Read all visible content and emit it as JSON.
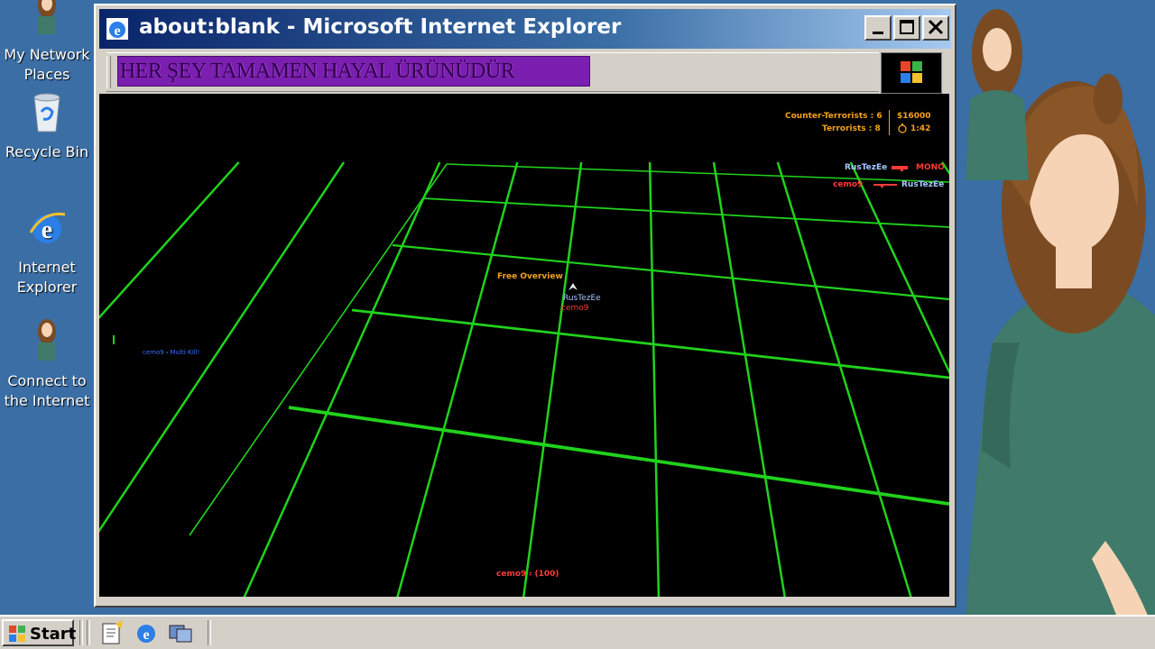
{
  "desktop": {
    "icons": [
      {
        "label": "My Network\nPlaces"
      },
      {
        "label": "Recycle Bin"
      },
      {
        "label": "Internet\nExplorer"
      },
      {
        "label": "Connect to\nthe Internet"
      }
    ]
  },
  "window": {
    "title": "about:blank - Microsoft Internet Explorer",
    "marquee": "HER ŞEY TAMAMEN HAYAL ÜRÜNÜDÜR"
  },
  "game": {
    "score": {
      "ct_label": "Counter-Terrorists : 6",
      "t_label": "Terrorists : 8",
      "money": "$16000",
      "timer": "1:42"
    },
    "killfeed": [
      {
        "killer": "RusTezEe",
        "weapon": "MONO"
      },
      {
        "killer": "cemo9",
        "victim": "RusTezEe"
      }
    ],
    "overview_label": "Free Overview",
    "player_name": "RusTezEe",
    "player_name_2": "cemo9",
    "left_notice": "cemo9 ⸗ Multi-Kill!",
    "bottom_status": "cemo9 ⸗ (100)",
    "colors": {
      "grid": "#21d21c",
      "hud_orange": "#f4a21c",
      "ct_blue": "#a6c6ff",
      "t_red": "#ff3a3a",
      "notice_blue": "#3a6cff"
    }
  },
  "taskbar": {
    "start_label": "Start",
    "quick_launch": [
      "notepad-icon",
      "internet-explorer-icon",
      "show-desktop-icon"
    ]
  }
}
